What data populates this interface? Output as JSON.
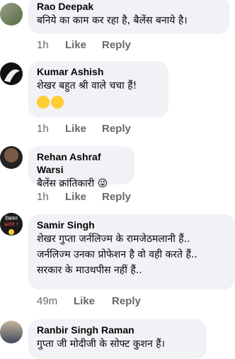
{
  "comments": [
    {
      "author": "Rao Deepak",
      "lines": [
        "बनिये का काम कर रहा है, बैलेंस बनाये है।"
      ],
      "time": "1h",
      "like": "Like",
      "reply": "Reply"
    },
    {
      "author": "Kumar Ashish",
      "lines": [
        "शेखर बहुत श्री वाले चचा हैं!"
      ],
      "emoji_line": true,
      "time": "1h",
      "like": "Like",
      "reply": "Reply"
    },
    {
      "author": "Rehan Ashraf Warsi",
      "lines": [
        "बैलेंस क्रांतिकारी 😜"
      ],
      "time": "1h",
      "like": "Like",
      "reply": "Reply"
    },
    {
      "author": "Samir Singh",
      "lines": [
        "शेखर गुप्ता जर्नलिज्म के रामजेठमलानी हैं..",
        "जर्नलिज्म उनका प्रोफेशन है वो वही करते हैं..",
        "सरकार के माउथपीस नहीं हैं.."
      ],
      "avatar_text": [
        "देखकर",
        "करोगे ?"
      ],
      "time": "49m",
      "like": "Like",
      "reply": "Reply"
    },
    {
      "author": "Ranbir Singh Raman",
      "lines": [
        "गुप्ता जी मोदीजी के सोफ्ट कुशन हैं।"
      ]
    }
  ],
  "colors": {
    "bubble": "#f0f2f5",
    "meta": "#65676b",
    "text": "#050505",
    "emoji": "#ffcc33"
  }
}
